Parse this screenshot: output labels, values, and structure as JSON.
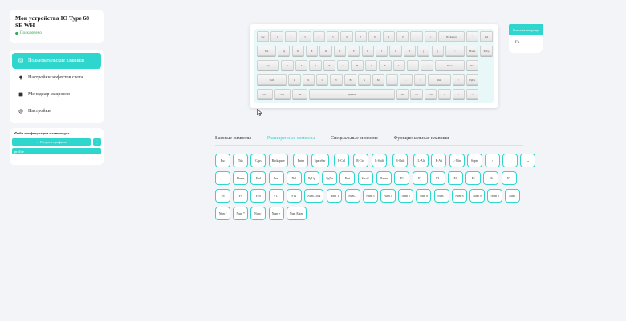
{
  "device": {
    "title": "Мои устройства IO Type 68 SE WH",
    "status": "Подключено"
  },
  "nav": {
    "items": [
      {
        "label": "Пользовательские клавиши",
        "icon": "keyboard-icon",
        "active": true
      },
      {
        "label": "Настройки эффектов света",
        "icon": "bulb-icon",
        "active": false
      },
      {
        "label": "Менеджер макросов",
        "icon": "macro-icon",
        "active": false
      },
      {
        "label": "Настройки",
        "icon": "gear-icon",
        "active": false
      }
    ]
  },
  "config": {
    "title": "Файл конфигурации клавиатуры",
    "create_label": "Создать профиль",
    "extra_label": "⋮",
    "profile_name": "profile"
  },
  "layers": {
    "active_label": "Слоевая матрица",
    "item": "Fn"
  },
  "tabs": [
    {
      "label": "Базовые символы",
      "active": false
    },
    {
      "label": "Расширенные символы",
      "active": true
    },
    {
      "label": "Специальные символы",
      "active": false
    },
    {
      "label": "Функциональные клавиши",
      "active": false
    }
  ],
  "symbols": [
    [
      "Esc",
      "Tab",
      "Caps",
      "Backspace",
      "Enter",
      "Spacebar",
      "L-Ctrl",
      "R-Ctrl",
      "L-Shift",
      "R-Shift",
      "L-Alt",
      "R-Alt",
      "L-Win",
      "Super",
      "↑",
      "↓",
      "→"
    ],
    [
      "←",
      "Home",
      "End",
      "Ins",
      "Del",
      "PgUp",
      "PgDn",
      "Prnt",
      "Scroll",
      "Pause",
      "F1",
      "F2",
      "F3",
      "F4",
      "F5",
      "F6",
      "F7"
    ],
    [
      "F8",
      "F9",
      "F10",
      "F11",
      "F12",
      "Num Lock",
      "Num 1",
      "Num 2",
      "Num 3",
      "Num 4",
      "Num 5",
      "Num 6",
      "Num 7",
      "Num 8",
      "Num 9",
      "Num 0",
      "Num ."
    ],
    [
      "Num /",
      "Num *",
      "Num -",
      "Num +",
      "Num Enter"
    ]
  ],
  "keyboard": {
    "rows": [
      [
        "Esc",
        "1",
        "2",
        "3",
        "4",
        "5",
        "6",
        "7",
        "8",
        "9",
        "0",
        "-",
        "=",
        "Backspace",
        "`",
        "Del"
      ],
      [
        "Tab",
        "Q",
        "W",
        "E",
        "R",
        "T",
        "Y",
        "U",
        "I",
        "O",
        "P",
        "[",
        "]",
        "\\",
        "Home",
        "PgUp"
      ],
      [
        "Caps",
        "A",
        "S",
        "D",
        "F",
        "G",
        "H",
        "J",
        "K",
        "L",
        ";",
        "'",
        "Enter",
        "End"
      ],
      [
        "Shift",
        "Z",
        "X",
        "C",
        "V",
        "B",
        "N",
        "M",
        ",",
        ".",
        "/",
        "Shift",
        "↑",
        "PgDn"
      ],
      [
        "Ctrl",
        "Win",
        "Alt",
        "Spacebar",
        "Alt",
        "Fn",
        "Ctrl",
        "←",
        "↓",
        "→"
      ]
    ]
  },
  "colors": {
    "accent": "#2ed6cd",
    "status": "#2eaa4e"
  }
}
